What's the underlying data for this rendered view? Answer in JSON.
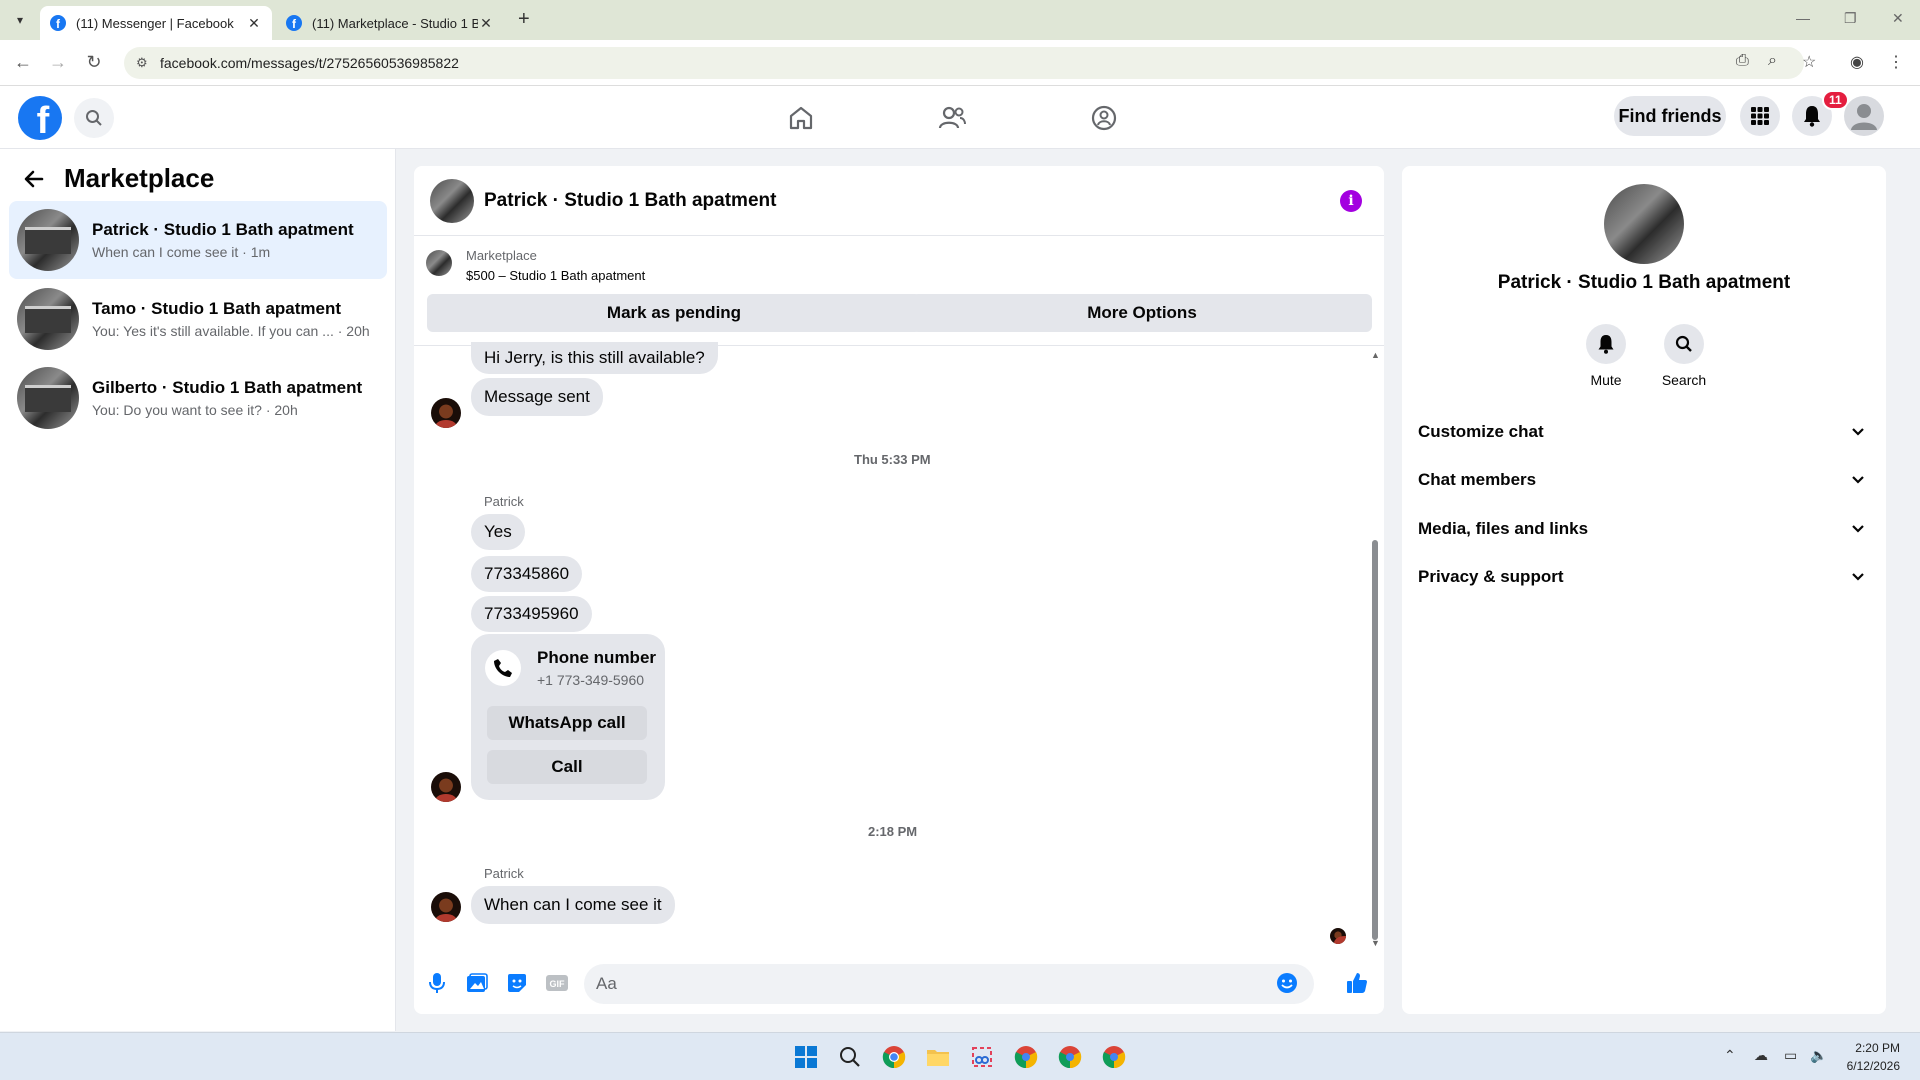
{
  "browser": {
    "tabs": [
      {
        "title": "(11) Messenger | Facebook",
        "active": true
      },
      {
        "title": "(11) Marketplace - Studio 1 Bath apatment",
        "active": false
      }
    ],
    "url": "facebook.com/messages/t/27526560536985822"
  },
  "header": {
    "find_friends": "Find friends",
    "notification_count": "11"
  },
  "sidebar": {
    "title": "Marketplace",
    "conversations": [
      {
        "name": "Patrick · Studio 1 Bath apatment",
        "preview": "When can I come see it · 1m",
        "active": true
      },
      {
        "name": "Tamo · Studio 1 Bath apatment",
        "preview": "You: Yes it's still available. If you can ... · 20h",
        "active": false
      },
      {
        "name": "Gilberto · Studio 1 Bath apatment",
        "preview": "You: Do you want to see it? · 20h",
        "active": false
      }
    ]
  },
  "chat": {
    "title": "Patrick · Studio 1 Bath apatment",
    "listing": {
      "category": "Marketplace",
      "title": "$500 – Studio 1 Bath apatment",
      "mark_pending": "Mark as pending",
      "more_options": "More Options"
    },
    "messages": {
      "m1": "Hi Jerry, is this still available?",
      "m2": "Message sent",
      "time1": "Thu 5:33 PM",
      "sender1": "Patrick",
      "m3": "Yes",
      "m4": "773345860",
      "m5": "7733495960",
      "phone_card": {
        "title": "Phone number",
        "number": "+1 773-349-5960",
        "whatsapp": "WhatsApp call",
        "call": "Call"
      },
      "time2": "2:18 PM",
      "sender2": "Patrick",
      "m6": "When can I come see it"
    },
    "composer_placeholder": "Aa"
  },
  "info_panel": {
    "name": "Patrick · Studio 1 Bath apatment",
    "mute": "Mute",
    "search": "Search",
    "sections": [
      "Customize chat",
      "Chat members",
      "Media, files and links",
      "Privacy & support"
    ]
  },
  "taskbar": {
    "time": "2:20 PM",
    "date": "6/12/2026"
  },
  "colors": {
    "accent": "#1877f2",
    "info_icon": "#a300e0",
    "badge": "#e41e3f"
  }
}
